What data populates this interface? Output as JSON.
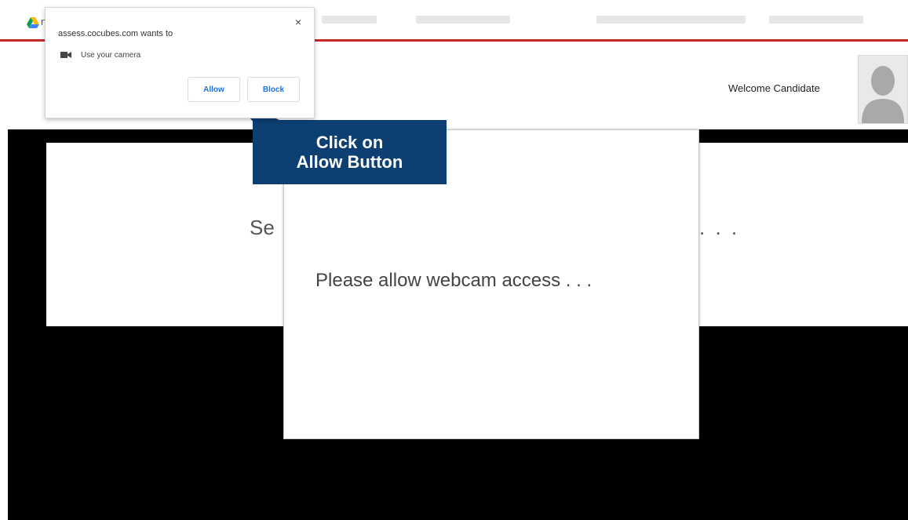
{
  "browser": {
    "tab_letter": "n",
    "drive_icon": "google-drive-icon"
  },
  "header": {
    "welcome_text": "Welcome Candidate",
    "avatar_icon": "user-avatar-icon"
  },
  "background_panel": {
    "left_fragment": "Se",
    "right_fragment": ". . ."
  },
  "modal": {
    "message": "Please allow webcam access . . ."
  },
  "permission_prompt": {
    "title": "assess.cocubes.com wants to",
    "item_label": "Use your camera",
    "item_icon": "camera-icon",
    "close_icon": "close-icon",
    "close_label": "×",
    "allow_label": "Allow",
    "block_label": "Block"
  },
  "callout": {
    "line1": "Click on",
    "line2": "Allow Button"
  },
  "colors": {
    "accent_red": "#c62828",
    "callout_blue": "#0d3f73",
    "button_blue": "#1a73e8"
  }
}
